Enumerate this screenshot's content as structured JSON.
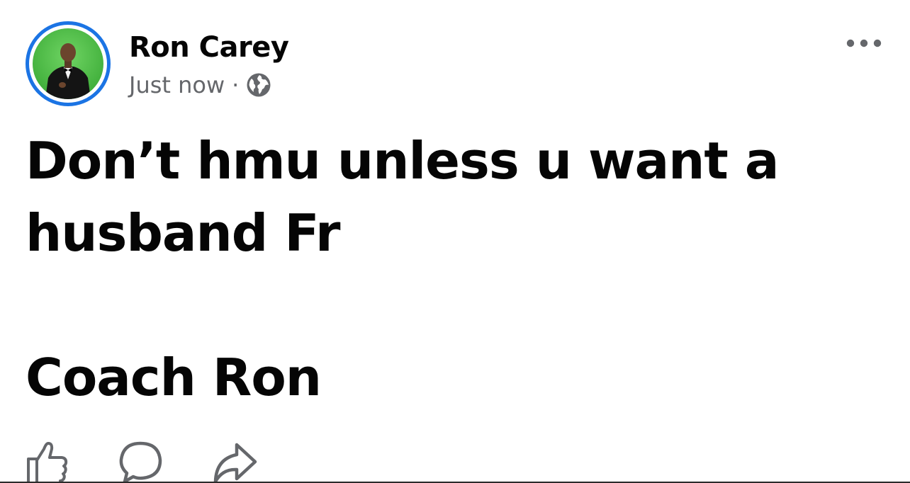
{
  "post": {
    "author": {
      "name": "Ron Carey",
      "avatar_ring_color": "#1b74e4"
    },
    "meta": {
      "time": "Just now",
      "separator": "·",
      "audience_icon": "globe-icon"
    },
    "menu_icon": "more-options-icon",
    "text_lines": [
      "Don’t hmu unless u want a",
      "husband Fr",
      "",
      "Coach Ron"
    ],
    "actions": [
      {
        "icon": "like-icon"
      },
      {
        "icon": "comment-icon"
      },
      {
        "icon": "share-icon"
      }
    ]
  }
}
